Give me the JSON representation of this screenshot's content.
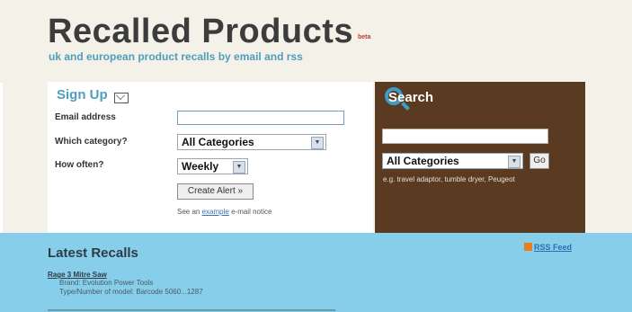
{
  "header": {
    "title": "Recalled Products",
    "beta": "beta",
    "tagline": "uk and european product recalls by email and rss"
  },
  "signup": {
    "heading": "Sign Up",
    "email_label": "Email address",
    "email_value": "",
    "category_label": "Which category?",
    "category_selected": "All Categories",
    "frequency_label": "How often?",
    "frequency_selected": "Weekly",
    "create_button": "Create Alert »",
    "sample_prefix": "See an",
    "sample_link": "example",
    "sample_suffix": "e-mail notice"
  },
  "search": {
    "heading": "Search",
    "query_value": "",
    "category_selected": "All Categories",
    "go_button": "Go",
    "hint": "e.g. travel adaptor, tumble dryer, Peugeot"
  },
  "recalls": {
    "heading": "Latest Recalls",
    "rss_label": "RSS Feed",
    "items": [
      {
        "title": "Rage 3 Mitre Saw",
        "lines": [
          "Brand: Evolution Power Tools",
          "Type/Number of model: Barcode 5060...1287"
        ]
      }
    ]
  },
  "icons": {
    "signup": "envelope-icon",
    "search": "magnifier-icon",
    "rss": "rss-icon"
  },
  "colors": {
    "accent": "#4f9dbf",
    "search_panel": "#5a3b22",
    "recalls_band": "#87ceea",
    "page_bg": "#f4f1e8"
  }
}
